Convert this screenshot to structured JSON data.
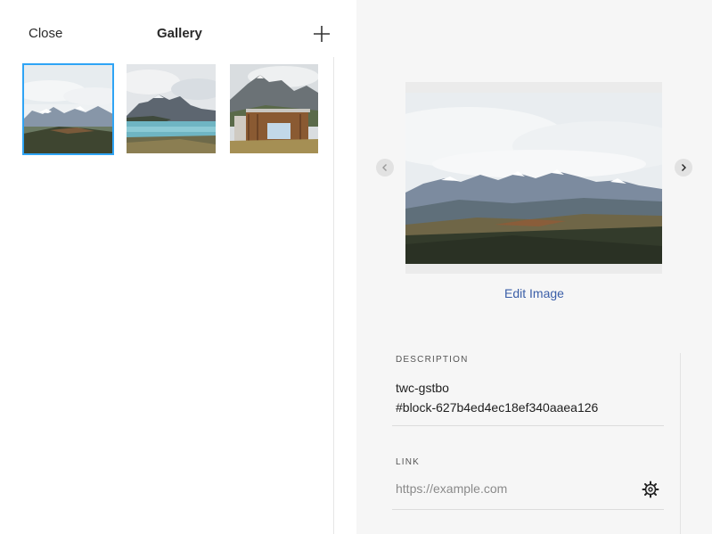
{
  "header": {
    "close_label": "Close",
    "title": "Gallery",
    "add_icon": "plus-icon"
  },
  "gallery": {
    "items": [
      {
        "name": "mountain-plateau",
        "selected": true
      },
      {
        "name": "lake-mountains",
        "selected": false
      },
      {
        "name": "wooden-cabin",
        "selected": false
      }
    ]
  },
  "preview": {
    "prev_icon": "chevron-left-icon",
    "next_icon": "chevron-right-icon",
    "edit_label": "Edit Image"
  },
  "description": {
    "label": "DESCRIPTION",
    "line1": "twc-gstbo",
    "line2": "#block-627b4ed4ec18ef340aaea126"
  },
  "link": {
    "label": "LINK",
    "placeholder": "https://example.com",
    "value": "",
    "settings_icon": "gear-icon"
  },
  "colors": {
    "accent": "#2fa4f5",
    "link": "#3a5ea8",
    "panel_bg": "#f6f6f6"
  }
}
